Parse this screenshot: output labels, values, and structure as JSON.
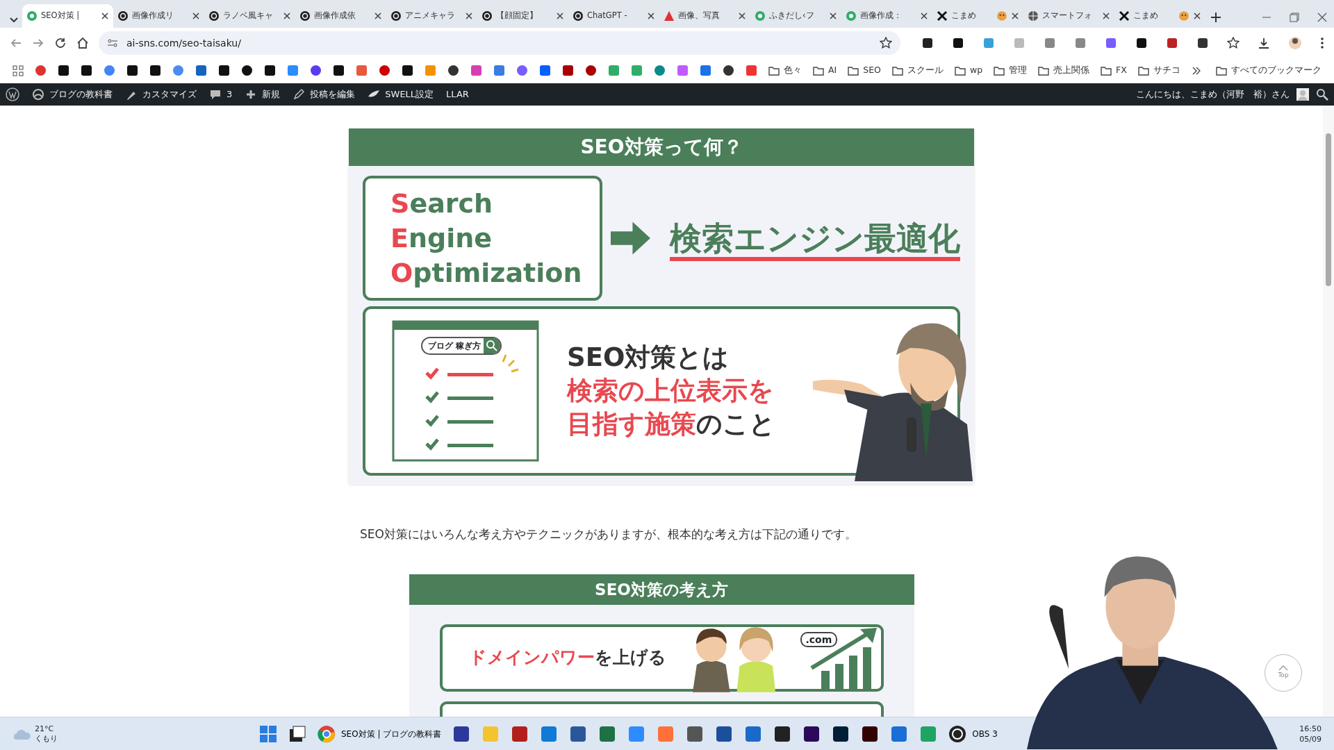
{
  "tabs": [
    {
      "title": "SEO対策 |",
      "selected": true
    },
    {
      "title": "画像作成リ",
      "selected": false
    },
    {
      "title": "ラノベ風キャ",
      "selected": false
    },
    {
      "title": "画像作成依",
      "selected": false
    },
    {
      "title": "アニメキャラ",
      "selected": false
    },
    {
      "title": "【顔固定】",
      "selected": false
    },
    {
      "title": "ChatGPT -",
      "selected": false
    },
    {
      "title": "画像、写真",
      "selected": false
    },
    {
      "title": "ふきだし‹フ",
      "selected": false
    },
    {
      "title": "画像作成：",
      "selected": false
    },
    {
      "title": "こまめ",
      "selected": false
    },
    {
      "title": "スマートフォ",
      "selected": false
    },
    {
      "title": "こまめ",
      "selected": false
    }
  ],
  "address": {
    "url": "ai-sns.com/seo-taisaku/"
  },
  "bookmark_folders": [
    "色々",
    "AI",
    "SEO",
    "スクール",
    "wp",
    "管理",
    "売上関係",
    "FX",
    "サチコ"
  ],
  "all_bookmarks": "すべてのブックマーク",
  "admin_bar": {
    "items": [
      "ブログの教科書",
      "カスタマイズ",
      "3",
      "新規",
      "投稿を編集",
      "SWELL設定",
      "LLAR"
    ],
    "greeting": "こんにちは、こまめ（河野　裕）さん"
  },
  "figure1": {
    "title": "SEO対策って何？",
    "acronym": [
      "**S**earch",
      "**E**ngine",
      "**O**ptimization"
    ],
    "meaning": "検索エンジン最適化",
    "search_box": "ブログ 稼ぎ方",
    "statement_lead": "SEO対策とは",
    "statement": "**検索の上位表示を目指す施策**のこと"
  },
  "paragraph": "SEO対策にはいろんな考え方やテクニックがありますが、根本的な考え方は下記の通りです。",
  "figure2": {
    "title": "SEO対策の考え方",
    "item": "**ドメインパワー**を上げる",
    "domain_label": ".com"
  },
  "top_button": "Top",
  "taskbar": {
    "temperature": "21°C",
    "weather": "くもり",
    "chrome_label": "SEO対策 | ブログの教科書",
    "obs_label": "OBS 3",
    "time": "16:50",
    "date": "05/09"
  }
}
